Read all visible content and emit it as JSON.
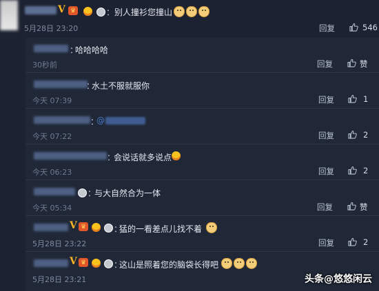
{
  "main_comment": {
    "text": "别人撞衫您撞山",
    "time": "5月28日 23:20",
    "reply_label": "回复",
    "like_count": "546"
  },
  "replies": [
    {
      "text": "哈哈哈哈",
      "time": "30秒前",
      "reply_label": "回复",
      "like_label": "赞"
    },
    {
      "text": "水土不服就服你",
      "time": "今天 07:39",
      "reply_label": "回复",
      "like_count": "1"
    },
    {
      "text": "@",
      "time": "今天 07:22",
      "reply_label": "回复",
      "like_count": "2"
    },
    {
      "text": "会说话就多说点",
      "time": "今天 06:23",
      "reply_label": "回复",
      "like_count": "2"
    },
    {
      "text": "与大自然合为一体",
      "time": "今天 05:34",
      "reply_label": "回复",
      "like_label": "赞"
    },
    {
      "text": "猛的一看差点儿找不着",
      "time": "5月28日 23:22",
      "reply_label": "回复",
      "like_count": "2"
    },
    {
      "text": "这山是照着您的脑袋长得吧",
      "time": "5月28日 23:21",
      "reply_label": "回复",
      "like_count": "2"
    }
  ],
  "labels": {
    "colon": "："
  },
  "badges": {
    "v": "V"
  },
  "watermark": "头条@悠悠闲云",
  "colors": {
    "background": "#1c2232",
    "panel": "#202838",
    "v_badge": "#f5b323"
  }
}
